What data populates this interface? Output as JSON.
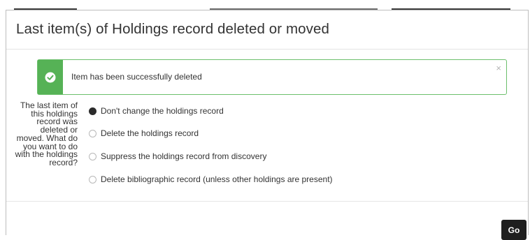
{
  "modal": {
    "title": "Last item(s) of Holdings record deleted or moved"
  },
  "alert": {
    "message": "Item has been successfully deleted",
    "close_glyph": "×",
    "icon": "check-circle-icon",
    "accent_color": "#56b256"
  },
  "form": {
    "question": "The last item of this holdings record was deleted or moved. What do you want to do with the holdings record?",
    "options": [
      {
        "label": "Don't change the holdings record",
        "selected": true
      },
      {
        "label": "Delete the holdings record",
        "selected": false
      },
      {
        "label": "Suppress the holdings record from discovery",
        "selected": false
      },
      {
        "label": "Delete bibliographic record (unless other holdings are present)",
        "selected": false
      }
    ]
  },
  "footer": {
    "go_label": "Go"
  }
}
